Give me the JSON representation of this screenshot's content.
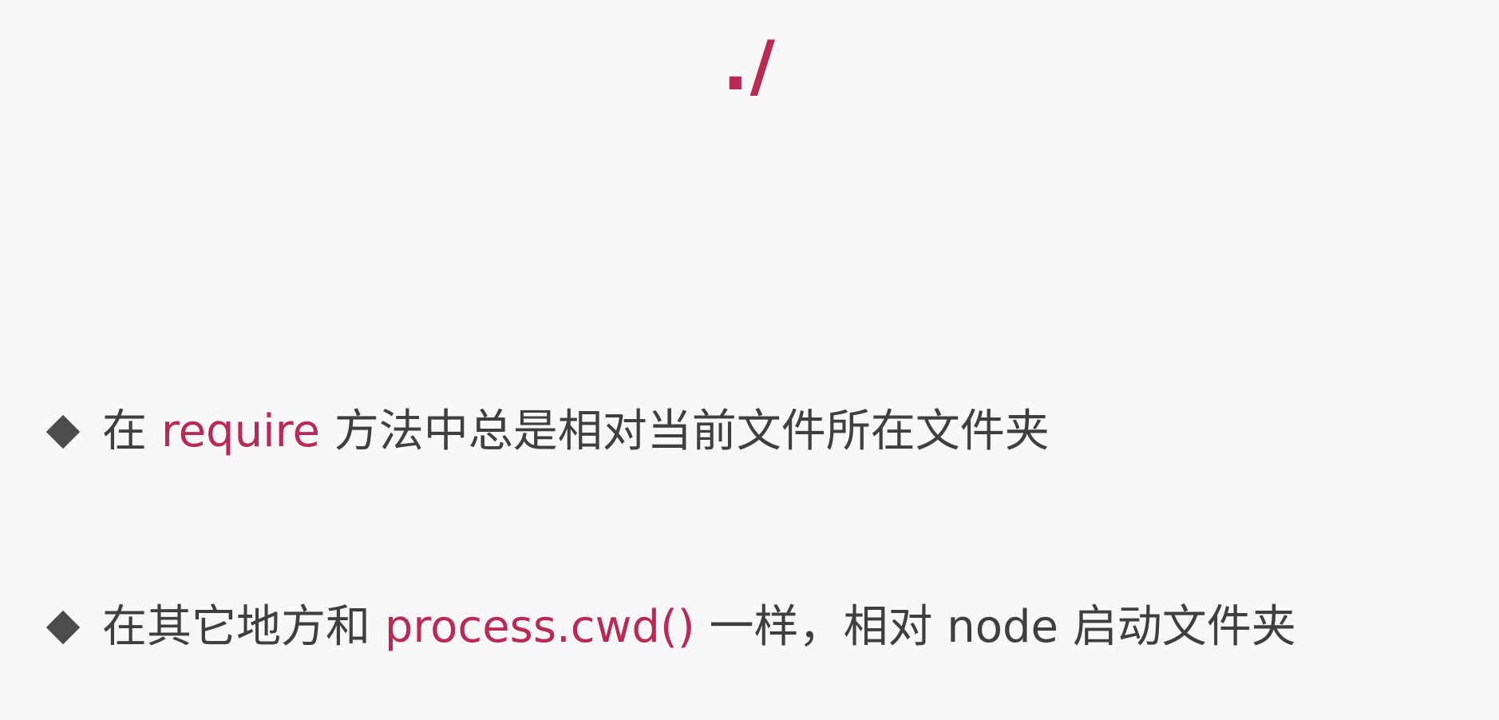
{
  "slide": {
    "title": "./",
    "bullets": [
      {
        "prefix": "在 ",
        "highlight": "require",
        "suffix": " 方法中总是相对当前文件所在文件夹"
      },
      {
        "prefix": "在其它地方和 ",
        "highlight": "process.cwd()",
        "suffix": " 一样，相对 node 启动文件夹"
      }
    ]
  },
  "colors": {
    "accent": "#b92a55",
    "body_text": "#3f3f3f",
    "bullet_marker": "#4c4c4c",
    "background": "#f8f8f8"
  }
}
